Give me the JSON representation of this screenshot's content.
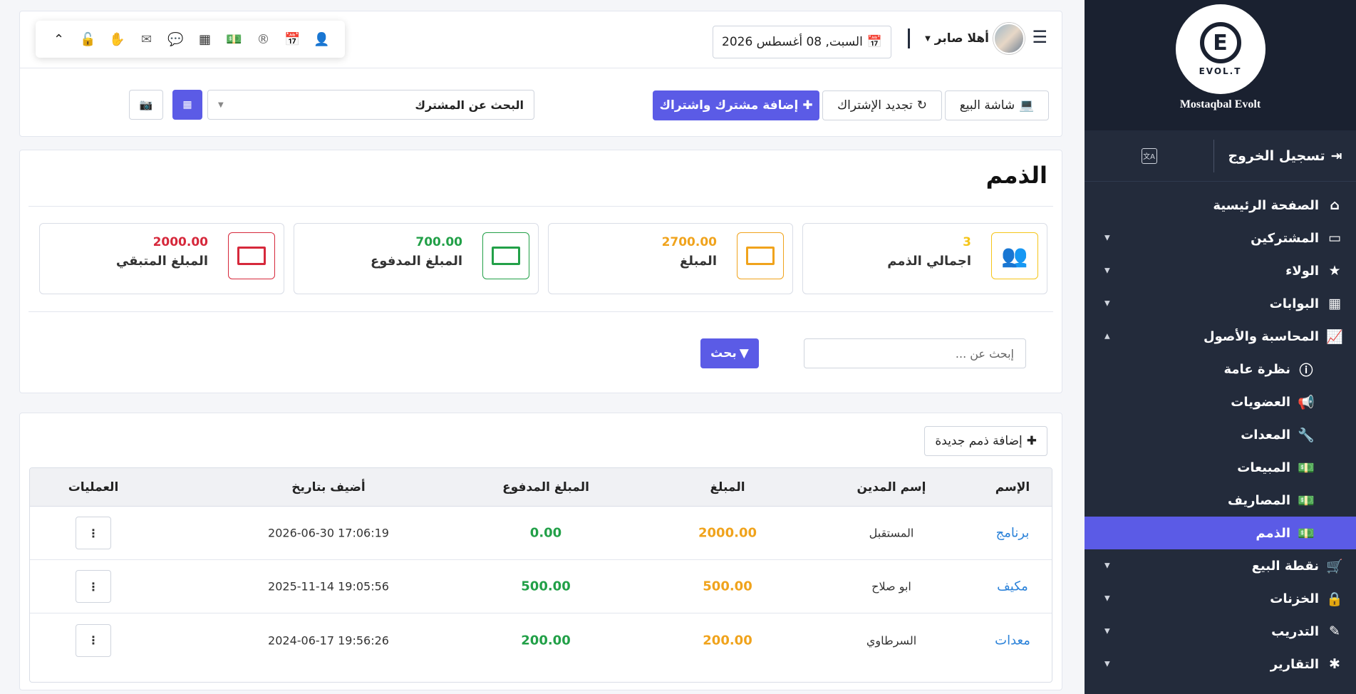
{
  "sidebar": {
    "brand": "Mostaqbal Evolt",
    "logo_text": "EVOL.T",
    "logo_letter": "E",
    "logout_label": "تسجيل الخروج",
    "lang_icon": "translate-icon",
    "items": [
      {
        "label": "الصفحة الرئيسية",
        "icon": "home-icon",
        "caret": false
      },
      {
        "label": "المشتركين",
        "icon": "laptop-icon",
        "caret": true
      },
      {
        "label": "الولاء",
        "icon": "star-icon",
        "caret": true
      },
      {
        "label": "البوابات",
        "icon": "building-icon",
        "caret": true
      },
      {
        "label": "المحاسبة والأصول",
        "icon": "chart-line-icon",
        "caret": true,
        "expanded": true
      },
      {
        "label": "نظرة عامة",
        "icon": "info-icon",
        "sub": true
      },
      {
        "label": "العضويات",
        "icon": "megaphone-icon",
        "sub": true
      },
      {
        "label": "المعدات",
        "icon": "wrench-icon",
        "sub": true
      },
      {
        "label": "المبيعات",
        "icon": "money-icon",
        "sub": true
      },
      {
        "label": "المصاريف",
        "icon": "money-icon",
        "sub": true
      },
      {
        "label": "الذمم",
        "icon": "money-icon",
        "sub": true,
        "active": true
      },
      {
        "label": "نقطة البيع",
        "icon": "cart-icon",
        "caret": true
      },
      {
        "label": "الخزنات",
        "icon": "lock-icon",
        "caret": true
      },
      {
        "label": "التدريب",
        "icon": "magic-icon",
        "caret": true
      },
      {
        "label": "التقارير",
        "icon": "bug-icon",
        "caret": true
      }
    ]
  },
  "topbar": {
    "greeting": "أهلا صابر",
    "date": "السبت, 08 أغسطس 2026",
    "pos_label": "شاشة البيع",
    "renew_label": "تجديد الإشتراك",
    "add_sub_label": "إضافة مشترك واشتراك",
    "search_sub_placeholder": "البحث عن المشترك"
  },
  "quickbar": [
    "expand-up-icon",
    "unlock-icon",
    "hand-icon",
    "envelope-icon",
    "comment-icon",
    "qrcode-icon",
    "money-icon",
    "registered-icon",
    "calendar-icon",
    "user-plus-icon"
  ],
  "page": {
    "title": "الذمم",
    "stats": [
      {
        "label": "اجمالي الذمم",
        "value": "3",
        "color": "#f5c518"
      },
      {
        "label": "المبلغ",
        "value": "2700.00",
        "color": "#f0a31c"
      },
      {
        "label": "المبلغ المدفوع",
        "value": "700.00",
        "color": "#22a048"
      },
      {
        "label": "المبلغ المتبقي",
        "value": "2000.00",
        "color": "#d6283b"
      }
    ],
    "search_placeholder": "إبحث عن ...",
    "search_button": "بحث"
  },
  "table": {
    "add_button": "إضافة ذمم جديدة",
    "headers": [
      "الإسم",
      "إسم المدين",
      "المبلغ",
      "المبلغ المدفوع",
      "أضيف بتاريخ",
      "العمليات"
    ],
    "rows": [
      {
        "name": "برنامج",
        "debtor": "المستقبل",
        "amount": "2000.00",
        "paid": "0.00",
        "date": "2026-06-30 17:06:19"
      },
      {
        "name": "مكيف",
        "debtor": "ابو صلاح",
        "amount": "500.00",
        "paid": "500.00",
        "date": "2025-11-14 19:05:56"
      },
      {
        "name": "معدات",
        "debtor": "السرطاوي",
        "amount": "200.00",
        "paid": "200.00",
        "date": "2024-06-17 19:56:26"
      }
    ]
  },
  "colors": {
    "primary": "#5b5be6",
    "sidebar": "#232b3b",
    "link": "#2b82d9"
  }
}
